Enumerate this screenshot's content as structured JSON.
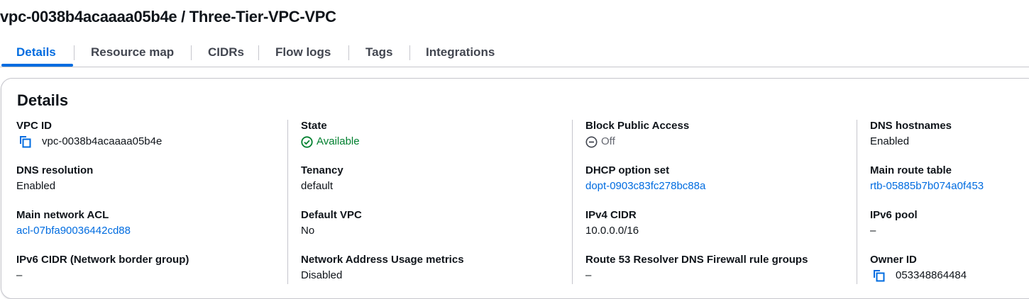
{
  "page": {
    "title": "vpc-0038b4acaaaa05b4e / Three-Tier-VPC-VPC"
  },
  "tabs": [
    {
      "label": "Details",
      "active": true
    },
    {
      "label": "Resource map"
    },
    {
      "label": "CIDRs"
    },
    {
      "label": "Flow logs"
    },
    {
      "label": "Tags"
    },
    {
      "label": "Integrations"
    }
  ],
  "details": {
    "heading": "Details",
    "fields": {
      "vpc_id": {
        "label": "VPC ID",
        "value": "vpc-0038b4acaaaa05b4e",
        "icon": "copy-icon"
      },
      "dns_resolution": {
        "label": "DNS resolution",
        "value": "Enabled"
      },
      "main_network_acl": {
        "label": "Main network ACL",
        "value": "acl-07bfa90036442cd88"
      },
      "ipv6_cidr": {
        "label": "IPv6 CIDR (Network border group)",
        "value": "–"
      },
      "state": {
        "label": "State",
        "value": "Available",
        "icon": "check-circle-icon"
      },
      "tenancy": {
        "label": "Tenancy",
        "value": "default"
      },
      "default_vpc": {
        "label": "Default VPC",
        "value": "No"
      },
      "nau_metrics": {
        "label": "Network Address Usage metrics",
        "value": "Disabled"
      },
      "block_public_access": {
        "label": "Block Public Access",
        "value": "Off",
        "icon": "minus-circle-icon"
      },
      "dhcp_option_set": {
        "label": "DHCP option set",
        "value": "dopt-0903c83fc278bc88a"
      },
      "ipv4_cidr": {
        "label": "IPv4 CIDR",
        "value": "10.0.0.0/16"
      },
      "route53_firewall": {
        "label": "Route 53 Resolver DNS Firewall rule groups",
        "value": "–"
      },
      "dns_hostnames": {
        "label": "DNS hostnames",
        "value": "Enabled"
      },
      "main_route_table": {
        "label": "Main route table",
        "value": "rtb-05885b7b074a0f453"
      },
      "ipv6_pool": {
        "label": "IPv6 pool",
        "value": "–"
      },
      "owner_id": {
        "label": "Owner ID",
        "value": "053348864484",
        "icon": "copy-icon"
      }
    }
  },
  "colors": {
    "link": "#006ce0",
    "success": "#00802f",
    "text": "#0f141a",
    "border": "#c6c6cd"
  }
}
